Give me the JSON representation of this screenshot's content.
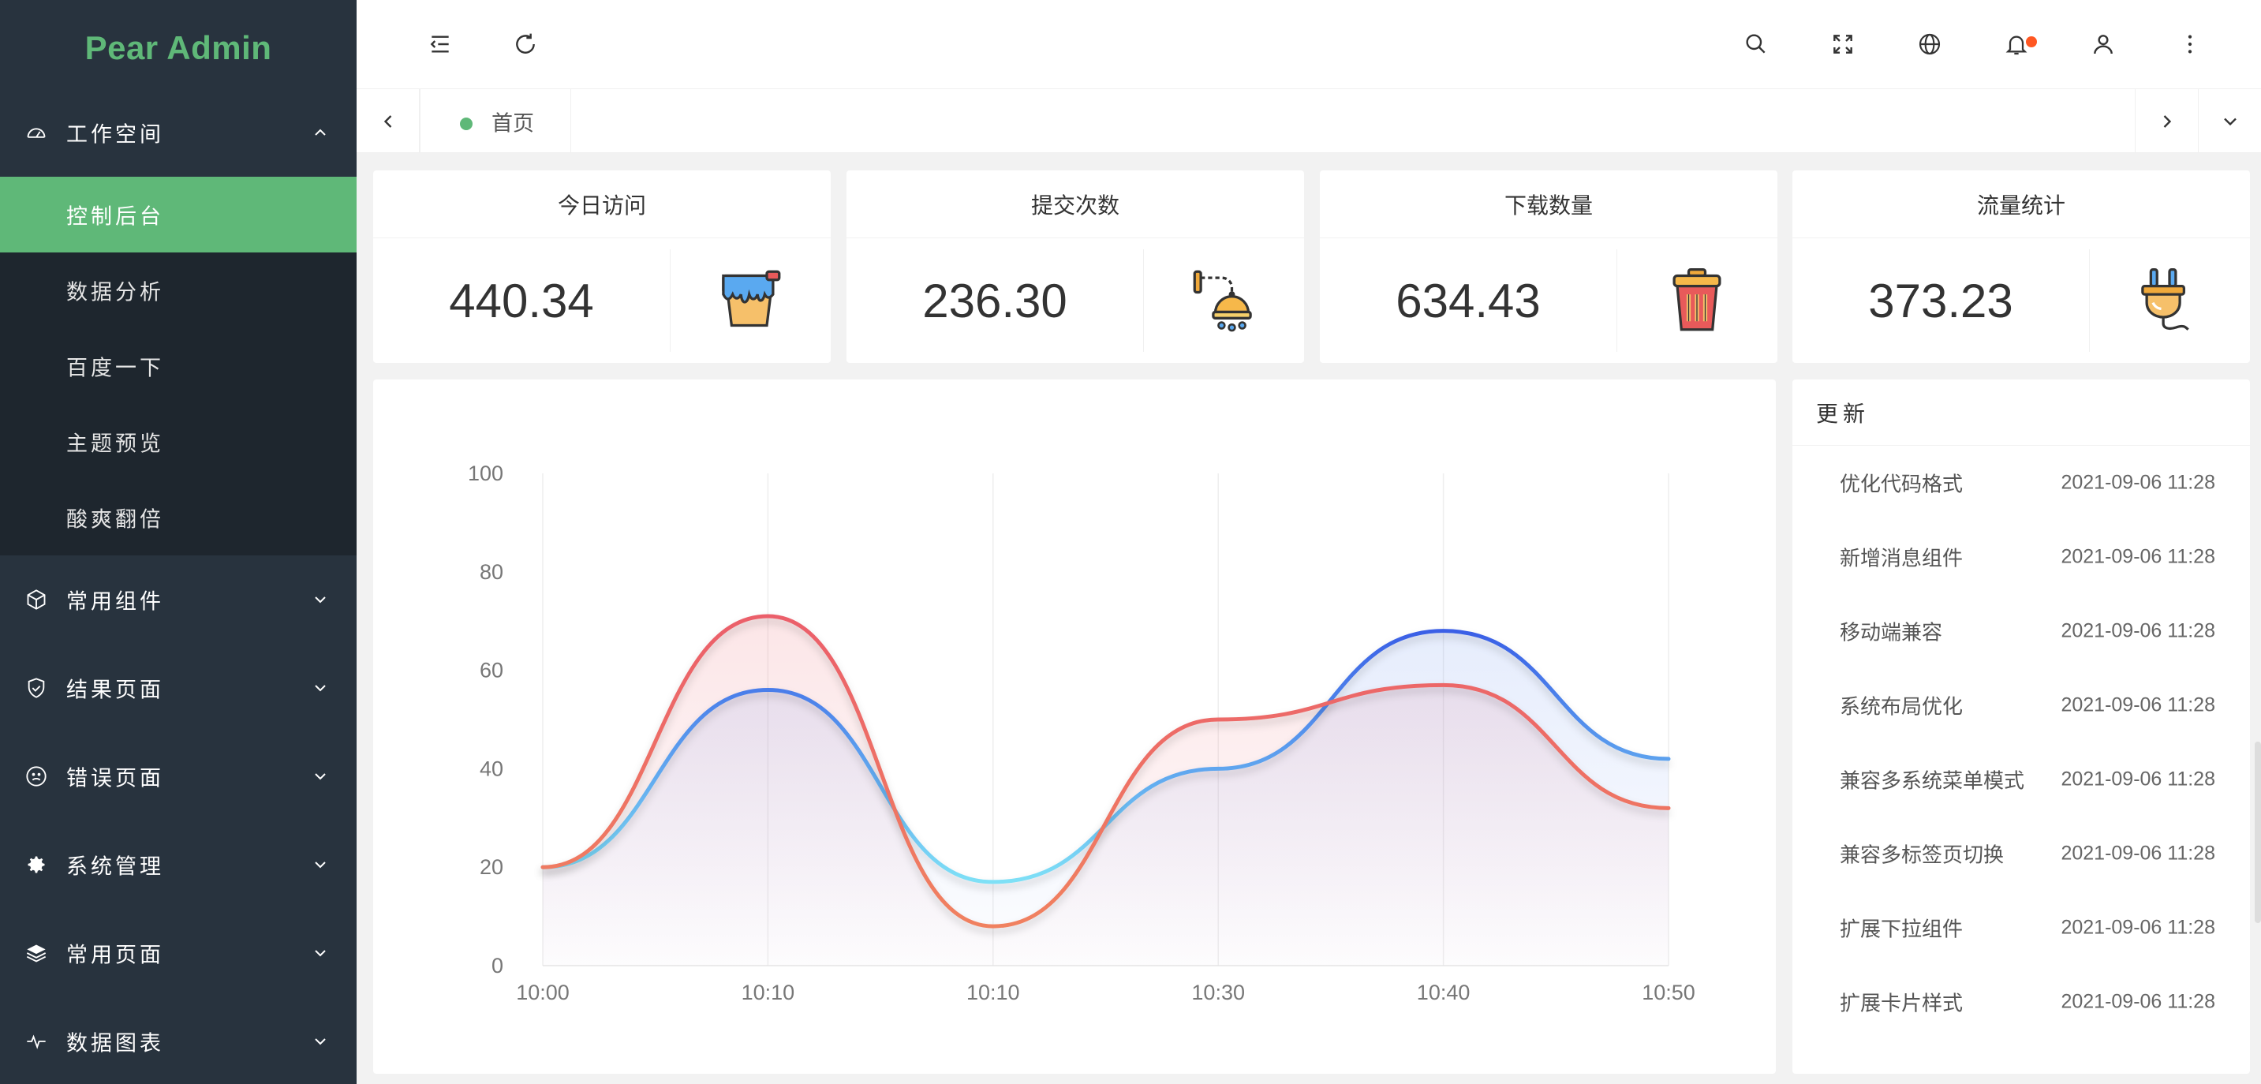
{
  "app": {
    "logo": "Pear Admin",
    "accent_color": "#5fb878",
    "sidebar_bg": "#28333e"
  },
  "sidebar": {
    "sections": [
      {
        "label": "工作空间",
        "icon": "dashboard-icon",
        "expanded": true
      },
      {
        "label": "常用组件",
        "icon": "cube-icon",
        "expanded": false
      },
      {
        "label": "结果页面",
        "icon": "shield-check-icon",
        "expanded": false
      },
      {
        "label": "错误页面",
        "icon": "sad-face-icon",
        "expanded": false
      },
      {
        "label": "系统管理",
        "icon": "gear-icon",
        "expanded": false
      },
      {
        "label": "常用页面",
        "icon": "layers-icon",
        "expanded": false
      },
      {
        "label": "数据图表",
        "icon": "pulse-icon",
        "expanded": false
      }
    ],
    "workspace_items": [
      {
        "label": "控制后台",
        "active": true
      },
      {
        "label": "数据分析",
        "active": false
      },
      {
        "label": "百度一下",
        "active": false
      },
      {
        "label": "主题预览",
        "active": false
      },
      {
        "label": "酸爽翻倍",
        "active": false
      }
    ]
  },
  "header": {
    "left_icons": [
      "collapse-menu-icon",
      "refresh-icon"
    ],
    "right_icons": [
      "search-icon",
      "fullscreen-icon",
      "globe-icon",
      "bell-icon",
      "user-icon",
      "more-icon"
    ],
    "notification_dot_color": "#ff5722"
  },
  "tabs": {
    "items": [
      {
        "label": "首页",
        "active": true
      }
    ]
  },
  "stats": [
    {
      "title": "今日访问",
      "value": "440.34",
      "icon": "paint-bucket-icon"
    },
    {
      "title": "提交次数",
      "value": "236.30",
      "icon": "shower-icon"
    },
    {
      "title": "下载数量",
      "value": "634.43",
      "icon": "trash-bin-icon"
    },
    {
      "title": "流量统计",
      "value": "373.23",
      "icon": "plug-icon"
    }
  ],
  "chart_data": {
    "type": "line",
    "smooth": true,
    "area_fill": true,
    "categories": [
      "10:00",
      "10:10",
      "10:10",
      "10:30",
      "10:40",
      "10:50"
    ],
    "ylim": [
      0,
      100
    ],
    "yticks": [
      0,
      20,
      40,
      60,
      80,
      100
    ],
    "grid": "vertical",
    "series": [
      {
        "values": [
          20,
          56,
          17,
          40,
          68,
          42
        ],
        "color": "#4b7bec"
      },
      {
        "values": [
          20,
          71,
          8,
          50,
          57,
          32
        ],
        "color": "#eb5f6a"
      }
    ]
  },
  "updates": {
    "title": "更新",
    "items": [
      {
        "text": "优化代码格式",
        "time": "2021-09-06 11:28"
      },
      {
        "text": "新增消息组件",
        "time": "2021-09-06 11:28"
      },
      {
        "text": "移动端兼容",
        "time": "2021-09-06 11:28"
      },
      {
        "text": "系统布局优化",
        "time": "2021-09-06 11:28"
      },
      {
        "text": "兼容多系统菜单模式",
        "time": "2021-09-06 11:28"
      },
      {
        "text": "兼容多标签页切换",
        "time": "2021-09-06 11:28"
      },
      {
        "text": "扩展下拉组件",
        "time": "2021-09-06 11:28"
      },
      {
        "text": "扩展卡片样式",
        "time": "2021-09-06 11:28"
      }
    ]
  }
}
